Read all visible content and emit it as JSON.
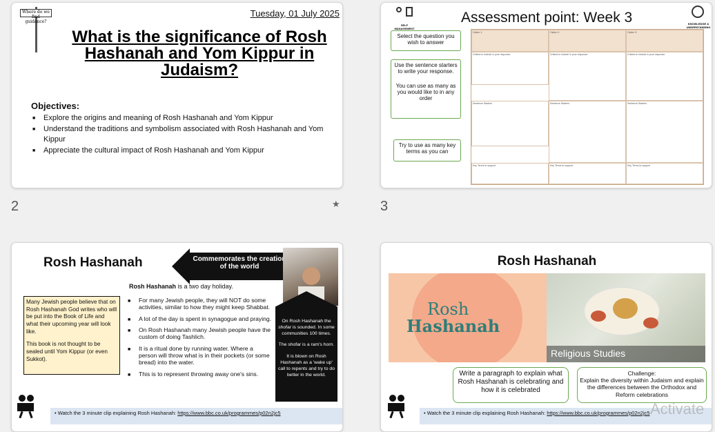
{
  "slides": [
    {
      "number": "2",
      "date": "Tuesday, 01 July 2025",
      "signpost": "Where do we find guidance?",
      "title": "What is the significance of Rosh Hashanah and Yom Kippur in Judaism?",
      "objectives_heading": "Objectives:",
      "objectives": [
        "Explore the origins and meaning of Rosh Hashanah and Yom Kippur",
        "Understand the traditions and symbolism associated with Rosh Hashanah and Yom Kippur",
        "Appreciate the cultural impact of Rosh Hashanah and Yom Kippur"
      ]
    },
    {
      "number": "3",
      "title": "Assessment point: Week 3",
      "icon_left_label": "SELF MANAGEMENT",
      "icon_right_label": "KNOWLEDGE & UNDERSTANDING",
      "callouts": [
        "Select the question you wish to answer",
        "Use the sentence starters to write your response.",
        "You can use as many as you would like to in any order",
        "Try to use as many key terms as you can"
      ],
      "columns": [
        "Option 1:",
        "Option 2:",
        "Option 3:"
      ],
      "rows": [
        "Criteria to include in your response:",
        "Sentence Starters",
        "Key Terms to support"
      ]
    },
    {
      "title": "Rosh Hashanah",
      "arrow_text": "Commemorates the creation of the world",
      "intro_bold": "Rosh Hashanah",
      "intro_rest": " is a two day holiday.",
      "bullets": [
        "For many Jewish people, they will NOT do some activities, similar to how they might keep Shabbat.",
        "A lot of the day is spent in synagogue and praying.",
        "On Rosh Hashanah many Jewish people have the custom of doing Tashlich.",
        "It is a ritual done by running water. Where a person will throw what is in their pockets (or some bread) into the water.",
        "This is to represent throwing away one's sins."
      ],
      "box_text1": "Many Jewish people believe that on Rosh Hashanah God writes who will be put into the Book of Life and what their upcoming year will look like.",
      "box_text2": "This book is not thought to be sealed until Yom Kippur (or even Sukkot).",
      "shofar_text": [
        "On Rosh Hashanah the shofar is sounded. In some communities 100 times.",
        "The shofar is a ram's horn.",
        "It is blown on Rosh Hashanah as a 'wake up' call to repents and try to do better in the world."
      ],
      "watch_text": "Watch the 3 minute clip explaining Rosh Hashanah: ",
      "watch_link": "https://www.bbc.co.uk/programmes/p02n2jc5"
    },
    {
      "title": "Rosh Hashanah",
      "video_title_1": "Rosh",
      "video_title_2": "Hashanah",
      "bbc": [
        "B",
        "B",
        "C"
      ],
      "video_caption": "Religious Studies",
      "task_text": "Write a paragraph to explain what Rosh Hashanah is celebrating and how it is celebrated",
      "challenge_heading": "Challenge:",
      "challenge_text": "Explain the diversity within Judaism and explain the differences between the Orthodox and Reform celebrations",
      "watch_text": "Watch the 3 minute clip explaining Rosh Hashanah: ",
      "watch_link": "https://www.bbc.co.uk/programmes/p02n2jc5",
      "watermark": "Activate"
    }
  ],
  "colors": {
    "green": "#6aa84f",
    "yellow": "#fff2cc",
    "black": "#111111",
    "peach": "#f3e1cf"
  }
}
